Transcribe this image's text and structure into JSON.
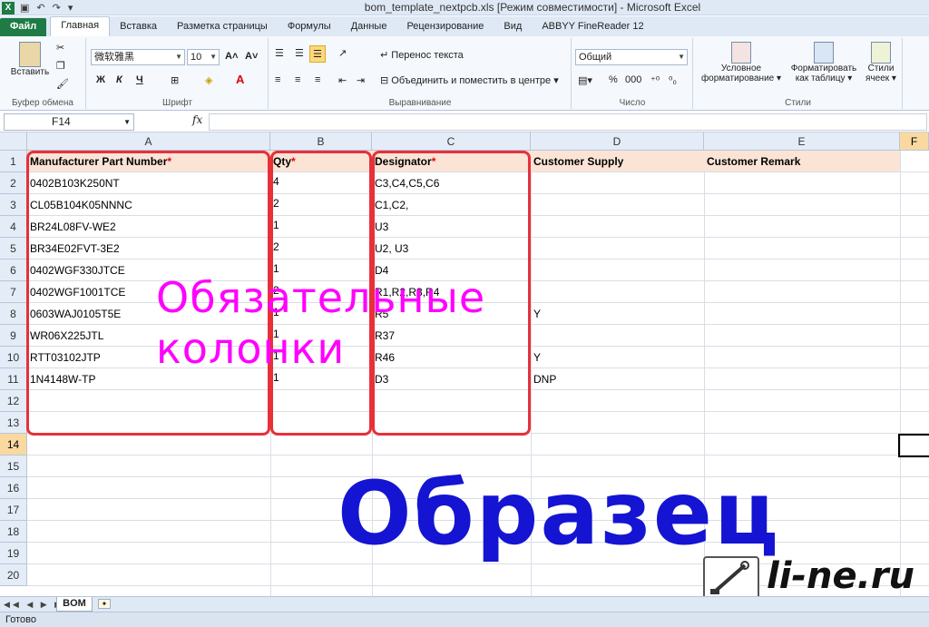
{
  "window": {
    "title": "bom_template_nextpcb.xls  [Режим совместимости]  -  Microsoft Excel",
    "app_icon": "X"
  },
  "ribbon_tabs": [
    "Файл",
    "Главная",
    "Вставка",
    "Разметка страницы",
    "Формулы",
    "Данные",
    "Рецензирование",
    "Вид",
    "ABBYY FineReader 12"
  ],
  "ribbon": {
    "clipboard": {
      "paste": "Вставить",
      "group": "Буфер обмена"
    },
    "font": {
      "name": "微软雅黑",
      "size": "10",
      "bold": "Ж",
      "italic": "К",
      "underline": "Ч",
      "group": "Шрифт"
    },
    "alignment": {
      "wrap": "Перенос текста",
      "merge": "Объединить и поместить в центре",
      "group": "Выравнивание"
    },
    "number": {
      "format": "Общий",
      "percent": "%",
      "thousands": "000",
      "group": "Число"
    },
    "styles": {
      "conditional_1": "Условное",
      "conditional_2": "форматирование",
      "format_table_1": "Форматировать",
      "format_table_2": "как таблицу",
      "cell_styles_1": "Стили",
      "cell_styles_2": "ячеек",
      "group": "Стили"
    }
  },
  "formula_bar": {
    "name_box": "F14",
    "fx": "fx",
    "formula": ""
  },
  "columns": [
    "A",
    "B",
    "C",
    "D",
    "E",
    "F"
  ],
  "rows": [
    "1",
    "2",
    "3",
    "4",
    "5",
    "6",
    "7",
    "8",
    "9",
    "10",
    "11",
    "12",
    "13",
    "14",
    "15",
    "16",
    "17",
    "18",
    "19",
    "20"
  ],
  "header": {
    "a": "Manufacturer Part Number",
    "b": "Qty",
    "c": "Designator",
    "d": "Customer Supply",
    "e": "Customer Remark",
    "asterisk": "*"
  },
  "data": [
    {
      "a": "0402B103K250NT",
      "b": "4",
      "c": "C3,C4,C5,C6",
      "d": ""
    },
    {
      "a": "CL05B104K05NNNC",
      "b": "2",
      "c": "C1,C2,",
      "d": ""
    },
    {
      "a": "BR24L08FV-WE2",
      "b": "1",
      "c": "U3",
      "d": ""
    },
    {
      "a": "BR34E02FVT-3E2",
      "b": "2",
      "c": "U2, U3",
      "d": ""
    },
    {
      "a": "0402WGF330JTCE",
      "b": "1",
      "c": "D4",
      "d": ""
    },
    {
      "a": "0402WGF1001TCE",
      "b": "2",
      "c": "R1,R2,R3,R4",
      "d": ""
    },
    {
      "a": "0603WAJ0105T5E",
      "b": "1",
      "c": "R5",
      "d": "Y"
    },
    {
      "a": "WR06X225JTL",
      "b": "1",
      "c": "R37",
      "d": ""
    },
    {
      "a": "RTT03102JTP",
      "b": "1",
      "c": "R46",
      "d": "Y"
    },
    {
      "a": "1N4148W-TP",
      "b": "1",
      "c": "D3",
      "d": "DNP"
    }
  ],
  "annotations": {
    "mandatory_line1": "Обязательные",
    "mandatory_line2": "колонки",
    "sample": "Образец"
  },
  "sheet_tabs": {
    "nav": "◀◀ ◀ ▶ ▶▶",
    "active": "BOM"
  },
  "status": {
    "text": "Готово"
  },
  "watermark": {
    "site": "li-ne.ru"
  }
}
